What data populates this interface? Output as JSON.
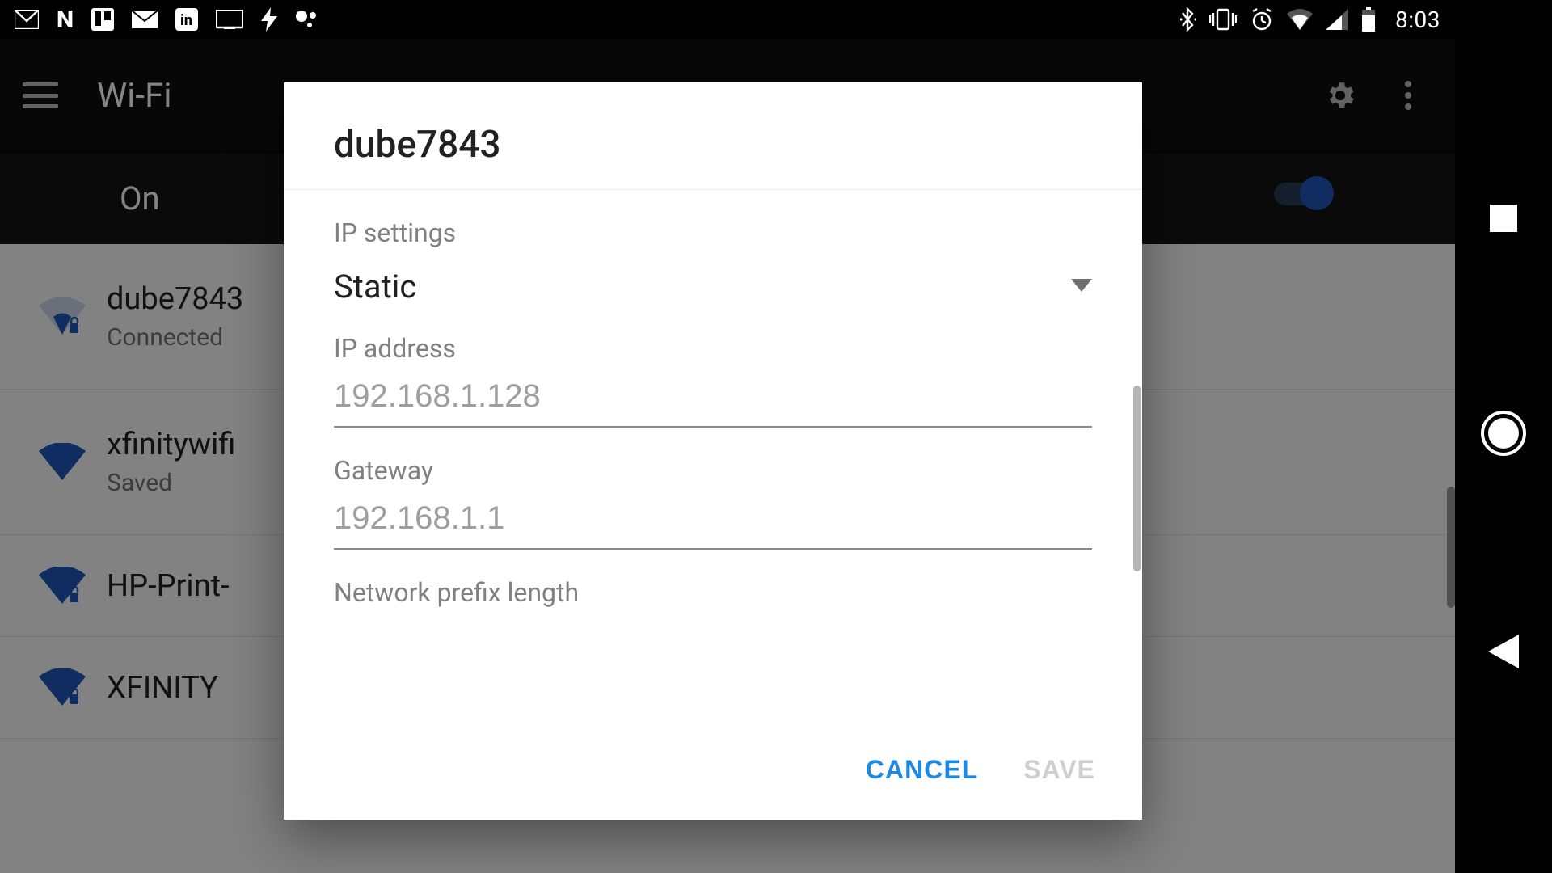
{
  "status_bar": {
    "clock": "8:03",
    "icons_left": [
      "gmail",
      "netflix",
      "trello",
      "mail",
      "linkedin",
      "screen-rec",
      "flash",
      "assistant"
    ],
    "icons_right": [
      "bluetooth",
      "vibrate",
      "alarm",
      "wifi",
      "cell-signal",
      "battery"
    ]
  },
  "toolbar": {
    "title": "Wi-Fi"
  },
  "wifi_toggle": {
    "label": "On",
    "on": true
  },
  "networks": [
    {
      "ssid": "dube7843",
      "status": "Connected",
      "signal": "weak",
      "secured": true
    },
    {
      "ssid": "xfinitywifi",
      "status": "Saved",
      "signal": "strong",
      "secured": false
    },
    {
      "ssid": "HP-Print-",
      "status": "",
      "signal": "strong",
      "secured": true
    },
    {
      "ssid": "XFINITY",
      "status": "",
      "signal": "strong",
      "secured": true
    }
  ],
  "dialog": {
    "title": "dube7843",
    "sections": {
      "ip_settings_label": "IP settings",
      "ip_settings_value": "Static",
      "ip_address_label": "IP address",
      "ip_address_placeholder": "192.168.1.128",
      "gateway_label": "Gateway",
      "gateway_placeholder": "192.168.1.1",
      "prefix_label": "Network prefix length"
    },
    "actions": {
      "cancel": "CANCEL",
      "save": "SAVE",
      "save_enabled": false
    }
  },
  "colors": {
    "accent": "#1e88e5",
    "wifi_icon": "#1e57b8"
  }
}
